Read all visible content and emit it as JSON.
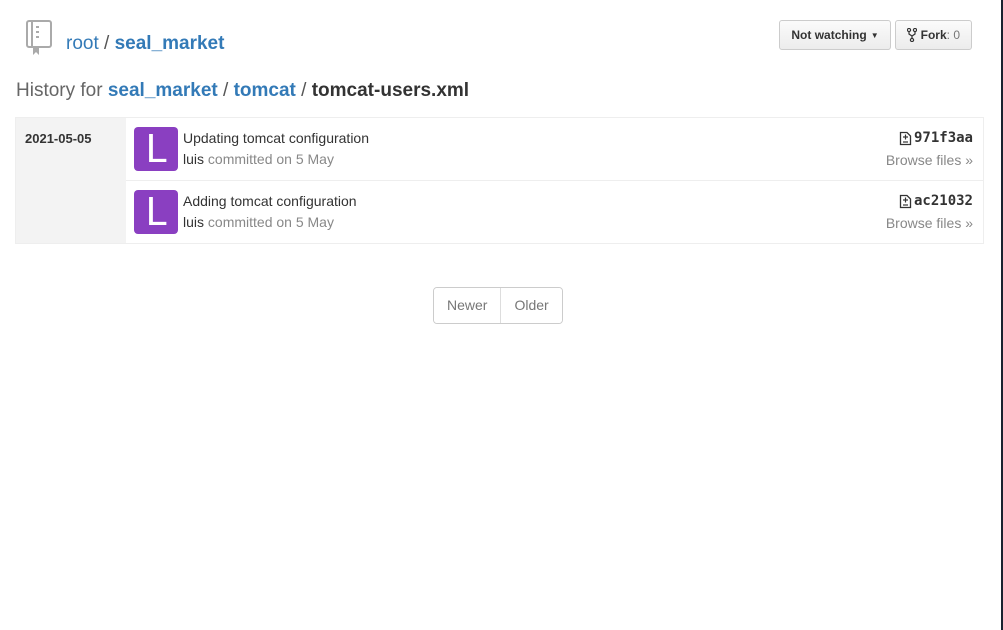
{
  "repo": {
    "owner": "root",
    "separator": "/",
    "name": "seal_market"
  },
  "actions": {
    "watch_label": "Not watching",
    "fork_label": "Fork",
    "fork_count": ": 0"
  },
  "history": {
    "prefix": "History for",
    "crumbs": [
      "seal_market",
      "tomcat"
    ],
    "file": "tomcat-users.xml",
    "sep": "/"
  },
  "commits_group": {
    "date": "2021-05-05",
    "commits": [
      {
        "avatar_letter": "L",
        "title": "Updating tomcat configuration",
        "author": "luis",
        "meta": "committed on 5 May",
        "sha": "971f3aa",
        "browse": "Browse files »"
      },
      {
        "avatar_letter": "L",
        "title": "Adding tomcat configuration",
        "author": "luis",
        "meta": "committed on 5 May",
        "sha": "ac21032",
        "browse": "Browse files »"
      }
    ]
  },
  "pager": {
    "newer": "Newer",
    "older": "Older"
  },
  "colors": {
    "link": "#337ab7",
    "avatar": "#8a3fc1"
  }
}
